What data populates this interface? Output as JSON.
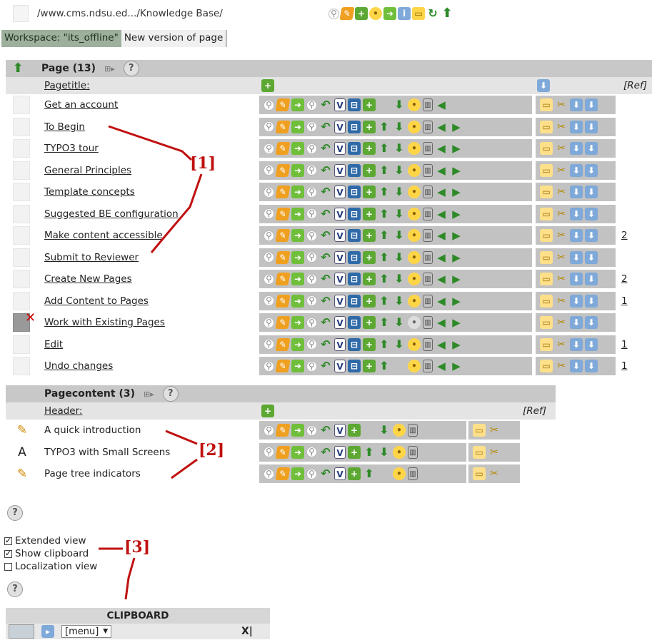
{
  "path": {
    "text": "/www.cms.ndsu.ed.../Knowledge Base/"
  },
  "workspace": {
    "label": "Workspace: \"its_offline\"",
    "version": "New version of page"
  },
  "page_table": {
    "title": "Page (13)",
    "column_title": "Pagetitle:",
    "ref_label": "[Ref]",
    "rows": [
      {
        "title": "Get an account",
        "ref": ""
      },
      {
        "title": "To Begin",
        "ref": ""
      },
      {
        "title": "TYPO3 tour",
        "ref": ""
      },
      {
        "title": "General Principles",
        "ref": ""
      },
      {
        "title": "Template concepts",
        "ref": ""
      },
      {
        "title": "Suggested BE configuration",
        "ref": ""
      },
      {
        "title": "Make content accessible",
        "ref": "2"
      },
      {
        "title": "Submit to Reviewer",
        "ref": ""
      },
      {
        "title": "Create New Pages",
        "ref": "2"
      },
      {
        "title": "Add Content to Pages",
        "ref": "1"
      },
      {
        "title": "Work with Existing Pages",
        "ref": ""
      },
      {
        "title": "Edit",
        "ref": "1"
      },
      {
        "title": "Undo changes",
        "ref": "1"
      }
    ]
  },
  "content_table": {
    "title": "Pagecontent (3)",
    "column_title": "Header:",
    "ref_label": "[Ref]",
    "rows": [
      {
        "title": "A quick introduction"
      },
      {
        "title": "TYPO3 with Small Screens"
      },
      {
        "title": "Page tree indicators"
      }
    ]
  },
  "callouts": {
    "c1": "[1]",
    "c2": "[2]",
    "c3": "[3]"
  },
  "options": {
    "extended": "Extended view",
    "clipboard": "Show clipboard",
    "localization": "Localization view"
  },
  "clipboard": {
    "title": "CLIPBOARD",
    "select": "[menu]",
    "close": "X|"
  },
  "glyphs": {
    "help": "?",
    "expand": "⊞▸",
    "x": "✕",
    "up": "⬆"
  }
}
